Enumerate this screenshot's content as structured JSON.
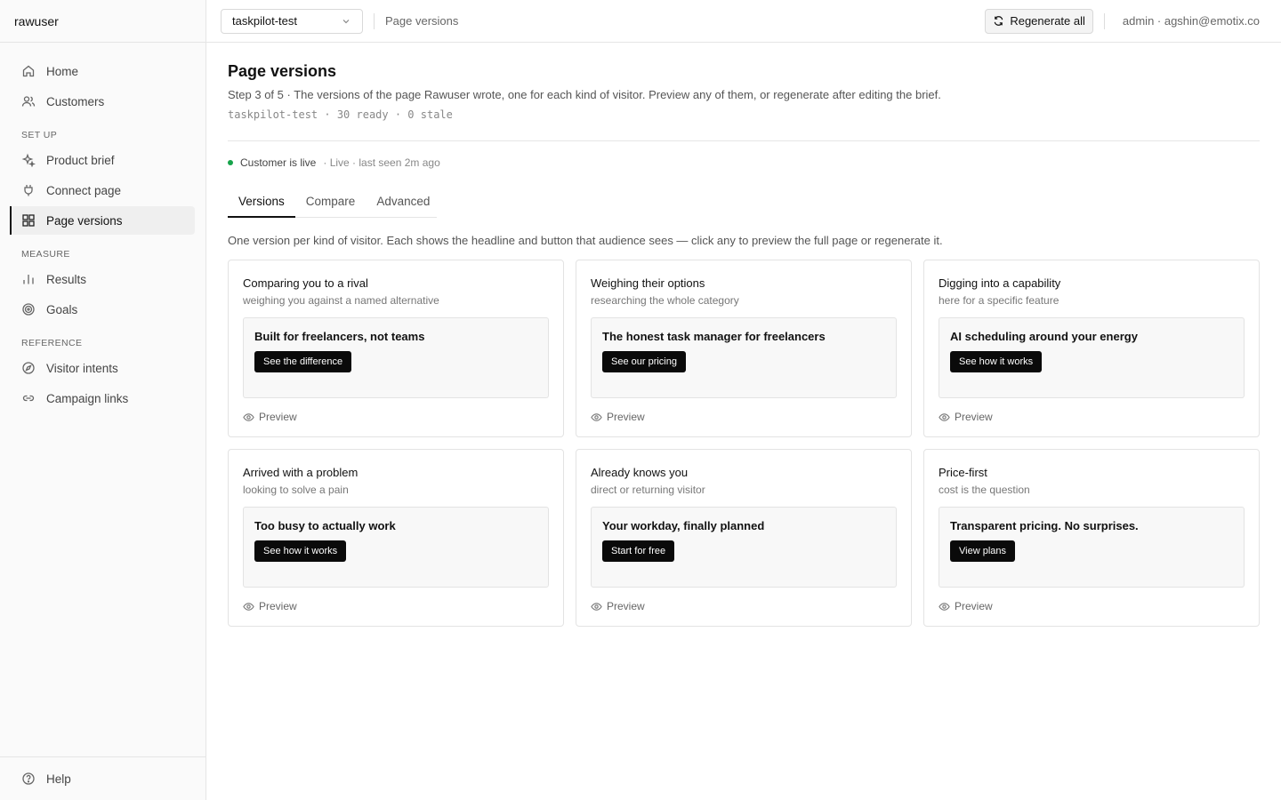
{
  "brand": "rawuser",
  "sidebar": {
    "items_top": [
      {
        "label": "Home",
        "icon": "home-icon"
      },
      {
        "label": "Customers",
        "icon": "users-icon"
      }
    ],
    "groups": [
      {
        "label": "SET UP",
        "items": [
          {
            "label": "Product brief",
            "icon": "sparkles-icon"
          },
          {
            "label": "Connect page",
            "icon": "plug-icon"
          },
          {
            "label": "Page versions",
            "icon": "grid-icon",
            "active": true
          }
        ]
      },
      {
        "label": "MEASURE",
        "items": [
          {
            "label": "Results",
            "icon": "bar-chart-icon"
          },
          {
            "label": "Goals",
            "icon": "target-icon"
          }
        ]
      },
      {
        "label": "REFERENCE",
        "items": [
          {
            "label": "Visitor intents",
            "icon": "compass-icon"
          },
          {
            "label": "Campaign links",
            "icon": "link-icon"
          }
        ]
      }
    ],
    "footer": {
      "label": "Help",
      "icon": "help-icon"
    }
  },
  "topbar": {
    "project": "taskpilot-test",
    "crumb": "Page versions",
    "regenerate_label": "Regenerate all",
    "user": "admin · agshin@emotix.co"
  },
  "page": {
    "title": "Page versions",
    "subtitle": "Step 3 of 5 · The versions of the page Rawuser wrote, one for each kind of visitor. Preview any of them, or regenerate after editing the brief.",
    "meta": "taskpilot-test · 30 ready · 0 stale",
    "live_label": "Customer is live",
    "live_meta": "· Live · last seen 2m ago",
    "status_color": "#16a34a",
    "tabs": [
      {
        "label": "Versions",
        "active": true
      },
      {
        "label": "Compare"
      },
      {
        "label": "Advanced"
      }
    ],
    "intro": "One version per kind of visitor. Each shows the headline and button that audience sees — click any to preview the full page or regenerate it.",
    "preview_label": "Preview",
    "cards": [
      {
        "title": "Comparing you to a rival",
        "sub": "weighing you against a named alternative",
        "headline": "Built for freelancers, not teams",
        "cta": "See the difference"
      },
      {
        "title": "Weighing their options",
        "sub": "researching the whole category",
        "headline": "The honest task manager for freelancers",
        "cta": "See our pricing"
      },
      {
        "title": "Digging into a capability",
        "sub": "here for a specific feature",
        "headline": "AI scheduling around your energy",
        "cta": "See how it works"
      },
      {
        "title": "Arrived with a problem",
        "sub": "looking to solve a pain",
        "headline": "Too busy to actually work",
        "cta": "See how it works"
      },
      {
        "title": "Already knows you",
        "sub": "direct or returning visitor",
        "headline": "Your workday, finally planned",
        "cta": "Start for free"
      },
      {
        "title": "Price-first",
        "sub": "cost is the question",
        "headline": "Transparent pricing. No surprises.",
        "cta": "View plans"
      }
    ]
  }
}
